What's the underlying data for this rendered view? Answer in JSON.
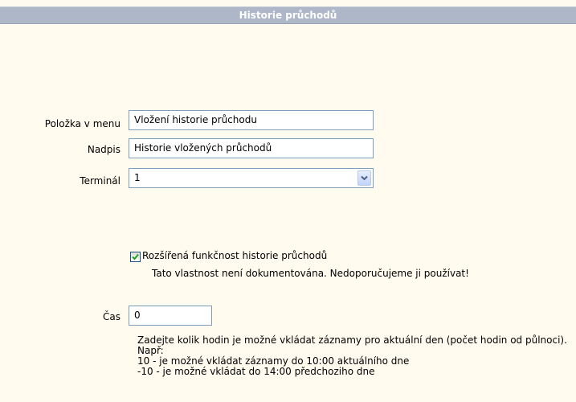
{
  "header": {
    "title": "Historie průchodů"
  },
  "form": {
    "menu_item": {
      "label": "Položka v menu",
      "value": "Vložení historie průchodu"
    },
    "heading": {
      "label": "Nadpis",
      "value": "Historie vložených průchodů"
    },
    "terminal": {
      "label": "Terminál",
      "value": "1"
    },
    "extended": {
      "checked": true,
      "label": "Rozšířená funkčnost historie průchodů",
      "note": "Tato vlastnost není dokumentována. Nedoporučujeme ji používat!"
    },
    "time": {
      "label": "Čas",
      "value": "0",
      "help": [
        "Zadejte kolik hodin je možné vkládat záznamy pro aktuální den (počet hodin od půlnoci).",
        "Např:",
        "10 - je možné vkládat záznamy do 10:00 aktuálního dne",
        "-10 - je možné vkládat do 14:00 předchoziho dne"
      ]
    }
  },
  "colors": {
    "page_background": "#fffbef",
    "header_background": "#aeb7c8",
    "field_border": "#7f9db9",
    "check_mark": "#21a121"
  }
}
